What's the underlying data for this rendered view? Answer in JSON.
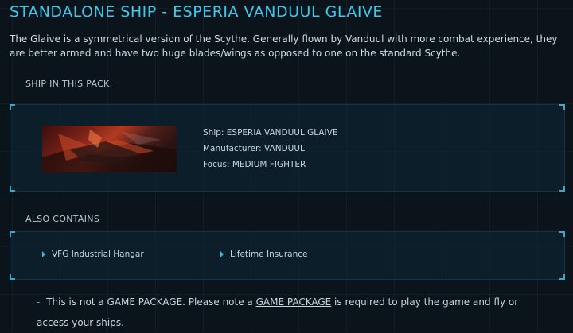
{
  "header": {
    "title": "STANDALONE SHIP - ESPERIA VANDUUL GLAIVE"
  },
  "description": "The Glaive is a symmetrical version of the Scythe. Generally flown by Vanduul with more combat experience, they are better armed and have two huge blades/wings as opposed to one on the standard Scythe.",
  "ship_section": {
    "label": "SHIP IN THIS PACK:",
    "ship": {
      "name_line": "Ship: ESPERIA VANDUUL GLAIVE",
      "manufacturer_line": "Manufacturer: VANDUUL",
      "focus_line": "Focus: MEDIUM FIGHTER"
    }
  },
  "also_contains": {
    "label": "ALSO CONTAINS",
    "items": [
      "VFG Industrial Hangar",
      "Lifetime Insurance"
    ]
  },
  "note": {
    "dash": "-",
    "before": "This is not a GAME PACKAGE. Please note a ",
    "link": "GAME PACKAGE",
    "after": " is required to play the game and fly or access your ships."
  },
  "colors": {
    "accent": "#3fc8ea",
    "background": "#0b141b",
    "panel_border": "#143447"
  }
}
